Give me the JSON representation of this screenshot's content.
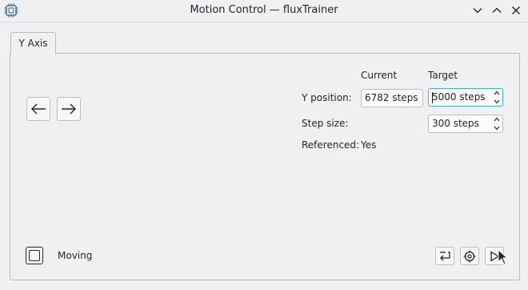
{
  "window": {
    "title": "Motion Control — fluxTrainer",
    "icons": [
      "chip-icon",
      "chevron-down-icon",
      "chevron-up-icon",
      "close-icon"
    ]
  },
  "tabs": [
    {
      "label": "Y Axis",
      "selected": true
    }
  ],
  "headers": {
    "current": "Current",
    "target": "Target"
  },
  "rows": {
    "y_position": {
      "label": "Y position:",
      "current": "6782 steps",
      "target": "5000 steps"
    },
    "step_size": {
      "label": "Step size:",
      "value": "300 steps"
    },
    "referenced": {
      "label": "Referenced:",
      "value": "Yes"
    }
  },
  "move_buttons": [
    "arrow-left-icon",
    "arrow-right-icon"
  ],
  "moving": {
    "label": "Moving",
    "checked": false
  },
  "toolbar_icons": [
    "return-icon",
    "crosshair-icon",
    "play-icon"
  ],
  "colors": {
    "focus": "#3daee9",
    "background": "#eff0f1",
    "text": "#232629"
  }
}
